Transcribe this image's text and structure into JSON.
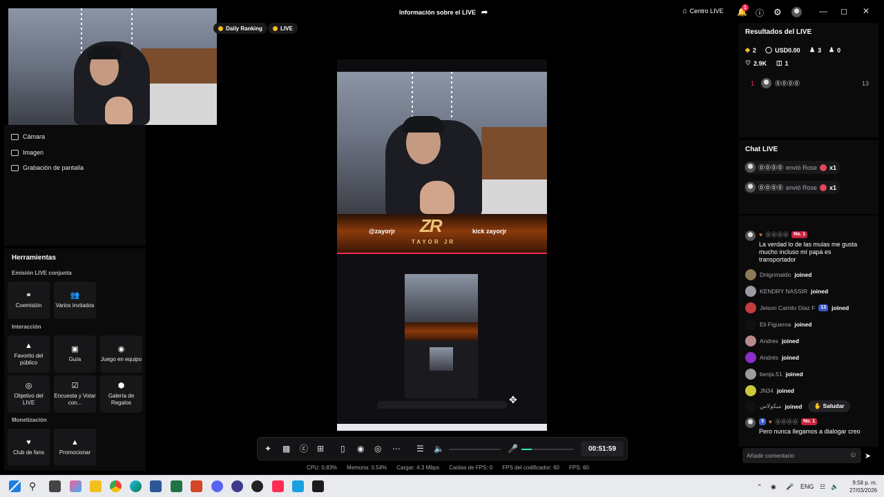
{
  "header": {
    "title": "Información sobre el LIVE",
    "centro_live": "Centro LIVE",
    "notification_count": "1"
  },
  "pills": [
    "Daily Ranking",
    "LIVE"
  ],
  "sources": [
    "Cámara",
    "Imagen",
    "Grabación de pantalla"
  ],
  "tools": {
    "title": "Herramientas",
    "sections": {
      "joint": "Emisión LIVE conjunta",
      "interaction": "Interacción",
      "monetization": "Monetización"
    },
    "joint_items": [
      "Coemisión",
      "Varios invitados"
    ],
    "interaction_items": [
      "Favorito del público",
      "Guía",
      "Juego en equipo",
      "Objetivo del LIVE",
      "Encuesta y Votar con...",
      "Galería de Regalos"
    ],
    "monetization_items": [
      "Club de fans",
      "Promocionar"
    ]
  },
  "stream": {
    "banner_handle_ig": "@zayorjr",
    "banner_kick": "kick",
    "banner_handle_kick": "zayorjr",
    "banner_logo": "ZR",
    "banner_name": "TAYOR JR"
  },
  "controls": {
    "timer": "00:51:59",
    "mic_level": 0.2
  },
  "stats": [
    "CPU: 0.83%",
    "Memoria: 0.54%",
    "Cargar: 4.3 Mbps",
    "Caídas de FPS: 0",
    "FPS del codificador: 60",
    "FPS: 60"
  ],
  "results": {
    "title": "Resultados del LIVE",
    "diamonds": "2",
    "usd": "USD0.00",
    "viewers": "3",
    "followers": "0",
    "likes": "2.9K",
    "gifts": "1",
    "rank": "1",
    "rank_name": "⓪⓪⓪⓪",
    "rank_score": "13"
  },
  "chat_live": {
    "title": "Chat LIVE",
    "gifts": [
      {
        "user": "⓪⓪⓪⓪",
        "action": "envió Rose",
        "count": "x1"
      },
      {
        "user": "⓪⓪⓪⓪",
        "action": "envió Rose",
        "count": "x1"
      }
    ]
  },
  "chat_feed": {
    "top_user": "⓪⓪⓪⓪",
    "top_badge": "No. 1",
    "top_message": "La verdad lo de las mulas me gusta mucho incluso mí papá es transportador",
    "joins": [
      {
        "user": "Dnlgrimaldo",
        "action": "joined"
      },
      {
        "user": "KENDRY NASSIR",
        "action": "joined"
      },
      {
        "user": "Jeison Camilo Diaz F",
        "badge": "13",
        "action": "joined"
      },
      {
        "user": "Eli Figueroa",
        "action": "joined"
      },
      {
        "user": "Andres",
        "action": "joined"
      },
      {
        "user": "Andrés",
        "action": "joined"
      },
      {
        "user": "benja.51",
        "action": "joined"
      },
      {
        "user": "JN34",
        "action": "joined"
      },
      {
        "user": "ميكولاس",
        "action": "joined",
        "button": "Saludar"
      }
    ],
    "bottom_level": "3",
    "bottom_user": "⓪⓪⓪⓪",
    "bottom_badge": "No. 1",
    "bottom_message": "Pero nunca llegamos a dialogar creo",
    "input_placeholder": "Añadir comentario"
  },
  "taskbar": {
    "lang": "ENG",
    "time": "9:58 p. m.",
    "date": "27/03/2026"
  },
  "colors": {
    "accent": "#fe2c55",
    "meter": "#25f4b0",
    "gold": "#f2c01b"
  }
}
